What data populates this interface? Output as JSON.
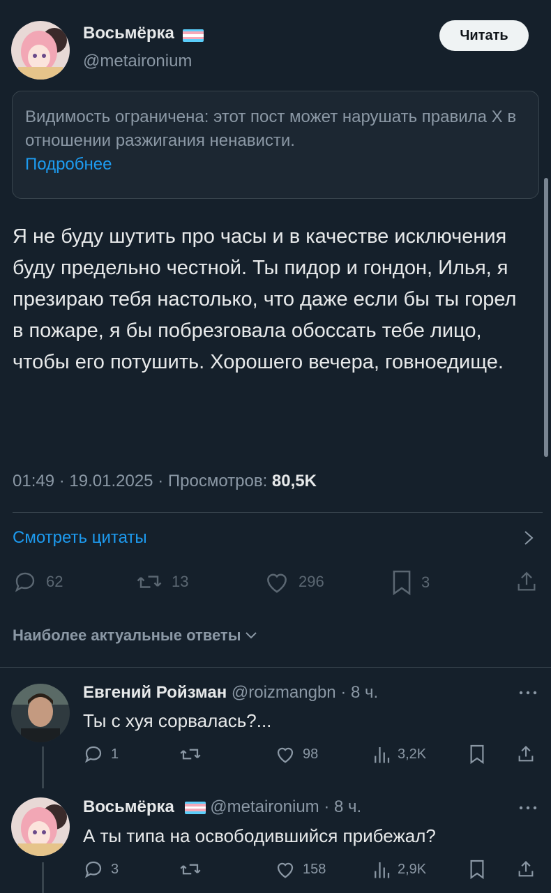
{
  "post": {
    "author_name": "Восьмёрка",
    "author_handle": "@metaironium",
    "read_button": "Читать",
    "notice_text": "Видимость ограничена: этот пост может нарушать правила X в отношении разжигания ненависти.",
    "notice_link": "Подробнее",
    "text": "Я не буду шутить про часы и в качестве исключения буду предельно честной. Ты пидор и гондон, Илья, я презираю тебя настолько, что даже если бы ты горел в пожаре, я бы побрезговала обоссать тебе лицо, чтобы его потушить. Хорошего вечера, говноедище.",
    "time": "01:49",
    "date": "19.01.2025",
    "views_label": "Просмотров:",
    "views_value": "80,5K",
    "quotes_link": "Смотреть цитаты",
    "stats": {
      "replies": "62",
      "reposts": "13",
      "likes": "296",
      "bookmarks": "3"
    }
  },
  "replies_section": {
    "title": "Наиболее актуальные ответы"
  },
  "replies": [
    {
      "name": "Евгений Ройзман",
      "handle": "@roizmangbn",
      "time": "8 ч.",
      "text": "Ты с хуя сорвалась?...",
      "stats": {
        "replies": "1",
        "reposts": "",
        "likes": "98",
        "views": "3,2K"
      }
    },
    {
      "name": "Восьмёрка",
      "handle": "@metaironium",
      "time": "8 ч.",
      "text": "А ты типа на освободившийся прибежал?",
      "stats": {
        "replies": "3",
        "reposts": "",
        "likes": "158",
        "views": "2,9K"
      }
    }
  ],
  "icons": {
    "reply": "reply-icon",
    "repost": "repost-icon",
    "like": "heart-icon",
    "bookmark": "bookmark-icon",
    "share": "share-icon",
    "views": "views-icon",
    "more": "more-icon",
    "chevron_right": "chevron-right-icon",
    "chevron_down": "chevron-down-icon"
  },
  "colors": {
    "background": "#15202b",
    "accent": "#1d9bf0",
    "text": "#e7e9ea",
    "muted": "#8b98a5",
    "flag": [
      "#5bcefa",
      "#f5a9b8",
      "#ffffff",
      "#f5a9b8",
      "#5bcefa"
    ]
  }
}
